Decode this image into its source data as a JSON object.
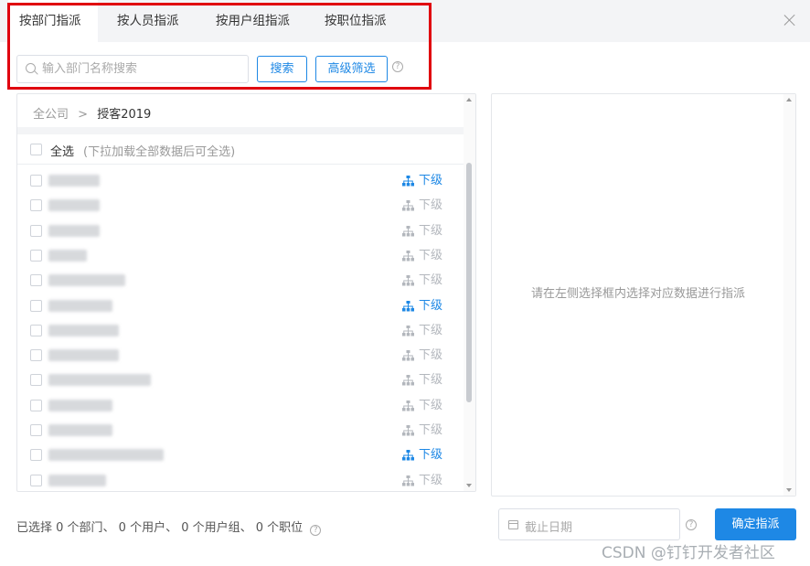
{
  "tabs": [
    {
      "label": "按部门指派",
      "active": true
    },
    {
      "label": "按人员指派",
      "active": false
    },
    {
      "label": "按用户组指派",
      "active": false
    },
    {
      "label": "按职位指派",
      "active": false
    }
  ],
  "search": {
    "placeholder": "输入部门名称搜索",
    "value": ""
  },
  "buttons": {
    "search": "搜索",
    "advanced_filter": "高级筛选",
    "confirm": "确定指派"
  },
  "breadcrumb": {
    "root": "全公司",
    "separator": ">",
    "current": "授客2019"
  },
  "select_all": {
    "label": "全选",
    "hint": "(下拉加载全部数据后可全选)"
  },
  "list": {
    "sub_label": "下级",
    "rows": [
      {
        "sub_active": true
      },
      {
        "sub_active": false
      },
      {
        "sub_active": false
      },
      {
        "sub_active": false
      },
      {
        "sub_active": false
      },
      {
        "sub_active": true
      },
      {
        "sub_active": false
      },
      {
        "sub_active": false
      },
      {
        "sub_active": false
      },
      {
        "sub_active": false
      },
      {
        "sub_active": false
      },
      {
        "sub_active": true
      },
      {
        "sub_active": false
      }
    ]
  },
  "right_panel": {
    "message": "请在左侧选择框内选择对应数据进行指派"
  },
  "footer": {
    "text": "已选择 0 个部门、 0 个用户、 0 个用户组、 0 个职位"
  },
  "deadline": {
    "placeholder": "截止日期"
  },
  "watermark": "CSDN @钉钉开发者社区",
  "colors": {
    "primary": "#1e88e5",
    "highlight": "#e0000f",
    "muted": "#b3b7bd"
  },
  "icons": {
    "close": "close-icon",
    "search": "search-icon",
    "help": "help-icon",
    "subordinate": "org-tree-icon",
    "calendar": "calendar-icon"
  }
}
